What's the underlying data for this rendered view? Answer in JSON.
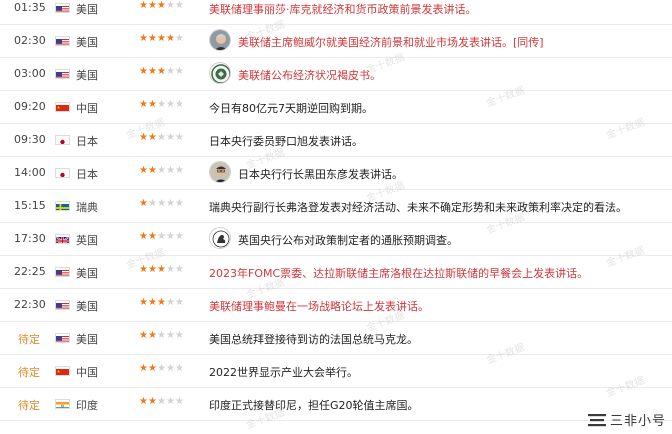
{
  "calendar": {
    "rows": [
      {
        "time": "01:35",
        "country": "美国",
        "flag": "us",
        "stars": 3,
        "avatar": "",
        "color": "red",
        "event": "美联储理事丽莎·库克就经济和货币政策前景发表讲话。"
      },
      {
        "time": "02:30",
        "country": "美国",
        "flag": "us",
        "stars": 4,
        "avatar": "powell-avatar",
        "color": "red",
        "event": "美联储主席鲍威尔就美国经济前景和就业市场发表讲话。[同传]"
      },
      {
        "time": "03:00",
        "country": "美国",
        "flag": "us",
        "stars": 3,
        "avatar": "fed-seal-avatar",
        "color": "red",
        "event": "美联储公布经济状况褐皮书。"
      },
      {
        "time": "09:20",
        "country": "中国",
        "flag": "cn",
        "stars": 2,
        "avatar": "",
        "color": "plain",
        "event": "今日有80亿元7天期逆回购到期。"
      },
      {
        "time": "09:30",
        "country": "日本",
        "flag": "jp",
        "stars": 2,
        "avatar": "",
        "color": "plain",
        "event": "日本央行委员野口旭发表讲话。"
      },
      {
        "time": "14:00",
        "country": "日本",
        "flag": "jp",
        "stars": 2,
        "avatar": "kuroda-avatar",
        "color": "plain",
        "event": "日本央行行长黑田东彦发表讲话。"
      },
      {
        "time": "15:15",
        "country": "瑞典",
        "flag": "se",
        "stars": 1,
        "avatar": "",
        "color": "plain",
        "event": "瑞典央行副行长弗洛登发表对经济活动、未来不确定形势和未来政策利率决定的看法。"
      },
      {
        "time": "17:30",
        "country": "英国",
        "flag": "gb",
        "stars": 2,
        "avatar": "boe-avatar",
        "color": "plain",
        "event": "英国央行公布对政策制定者的通胀预期调查。"
      },
      {
        "time": "22:25",
        "country": "美国",
        "flag": "us",
        "stars": 3,
        "avatar": "",
        "color": "red",
        "event": "2023年FOMC票委、达拉斯联储主席洛根在达拉斯联储的早餐会上发表讲话。"
      },
      {
        "time": "22:30",
        "country": "美国",
        "flag": "us",
        "stars": 3,
        "avatar": "",
        "color": "red",
        "event": "美联储理事鲍曼在一场战略论坛上发表讲话。"
      },
      {
        "time": "待定",
        "country": "美国",
        "flag": "us",
        "stars": 2,
        "avatar": "",
        "color": "plain",
        "event": "美国总统拜登接待到访的法国总统马克龙。"
      },
      {
        "time": "待定",
        "country": "中国",
        "flag": "cn",
        "stars": 2,
        "avatar": "",
        "color": "plain",
        "event": "2022世界显示产业大会举行。"
      },
      {
        "time": "待定",
        "country": "印度",
        "flag": "in",
        "stars": 2,
        "avatar": "",
        "color": "plain",
        "event": "印度正式接替印尼，担任G20轮值主席国。"
      }
    ]
  },
  "watermark": {
    "text": "金十数据"
  },
  "brand": {
    "text": "三非小号"
  },
  "colors": {
    "accent_red": "#d0383b",
    "star_orange": "#f07a18",
    "pending_orange": "#e0892b"
  }
}
